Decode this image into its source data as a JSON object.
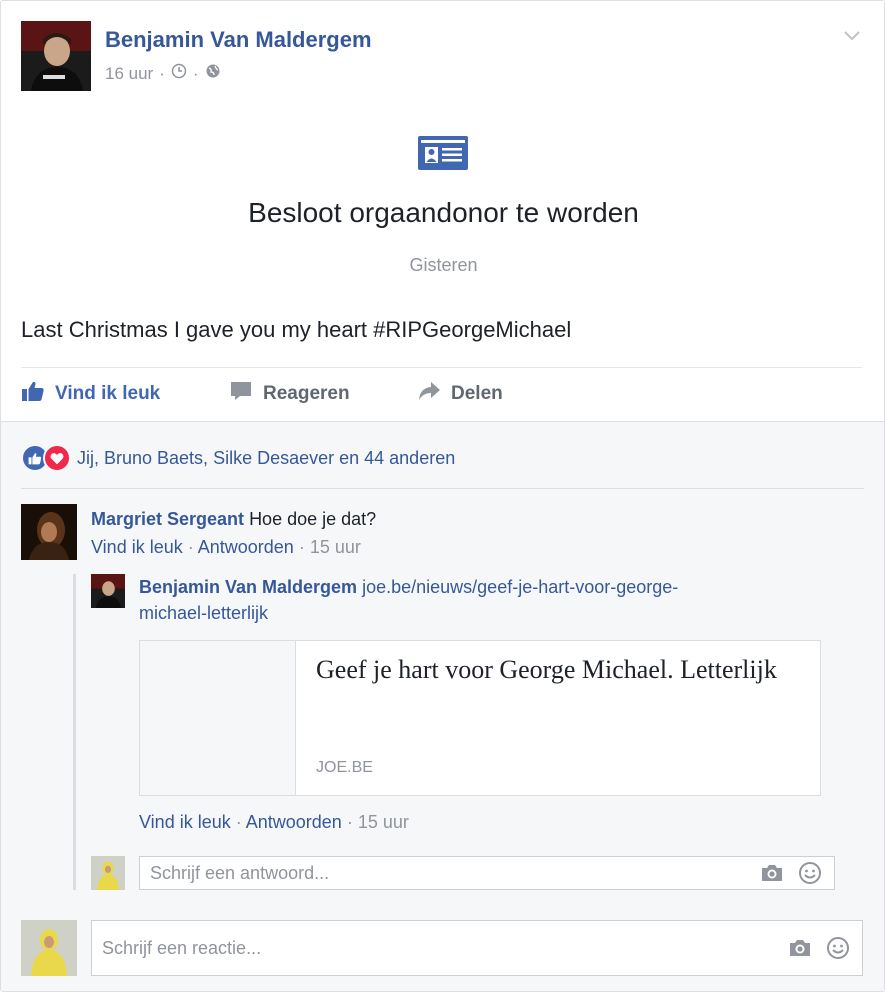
{
  "post": {
    "author": "Benjamin Van Maldergem",
    "time": "16 uur",
    "time_sep1": "·",
    "time_sep2": "·",
    "event_title": "Besloot orgaandonor te worden",
    "event_date": "Gisteren",
    "text": "Last Christmas I gave you my heart #RIPGeorgeMichael"
  },
  "actions": {
    "like": "Vind ik leuk",
    "comment": "Reageren",
    "share": "Delen"
  },
  "reactions": {
    "summary": "Jij, Bruno Baets, Silke Desaever en 44 anderen"
  },
  "comment1": {
    "author": "Margriet Sergeant",
    "text": "Hoe doe je dat?",
    "like": "Vind ik leuk",
    "sep1": " · ",
    "reply": "Antwoorden",
    "sep2": " · ",
    "time": "15 uur"
  },
  "reply1": {
    "author": "Benjamin Van Maldergem",
    "link_line1": "joe.be/nieuws/geef-je-hart-voor-george-",
    "link_line2": "michael-letterlijk",
    "card_title": "Geef je hart voor George Michael. Letterlijk",
    "card_domain": "JOE.BE",
    "like": "Vind ik leuk",
    "sep1": " · ",
    "reply": "Antwoorden",
    "sep2": " · ",
    "time": "15 uur"
  },
  "reply_input": {
    "placeholder": "Schrijf een antwoord..."
  },
  "comment_input": {
    "placeholder": "Schrijf een reactie..."
  },
  "icons": {
    "chevron": "chevron-down-icon",
    "clock": "clock-icon",
    "globe": "globe-icon",
    "event": "id-card-icon",
    "like": "thumbs-up-icon",
    "comment": "comment-bubble-icon",
    "share": "share-arrow-icon",
    "camera": "camera-icon",
    "emoji": "smiley-icon"
  },
  "colors": {
    "link_blue": "#365899",
    "action_blue": "#4267b2",
    "love_red": "#f0284a",
    "muted_gray": "#90949c",
    "comments_bg": "#f6f7f9"
  }
}
